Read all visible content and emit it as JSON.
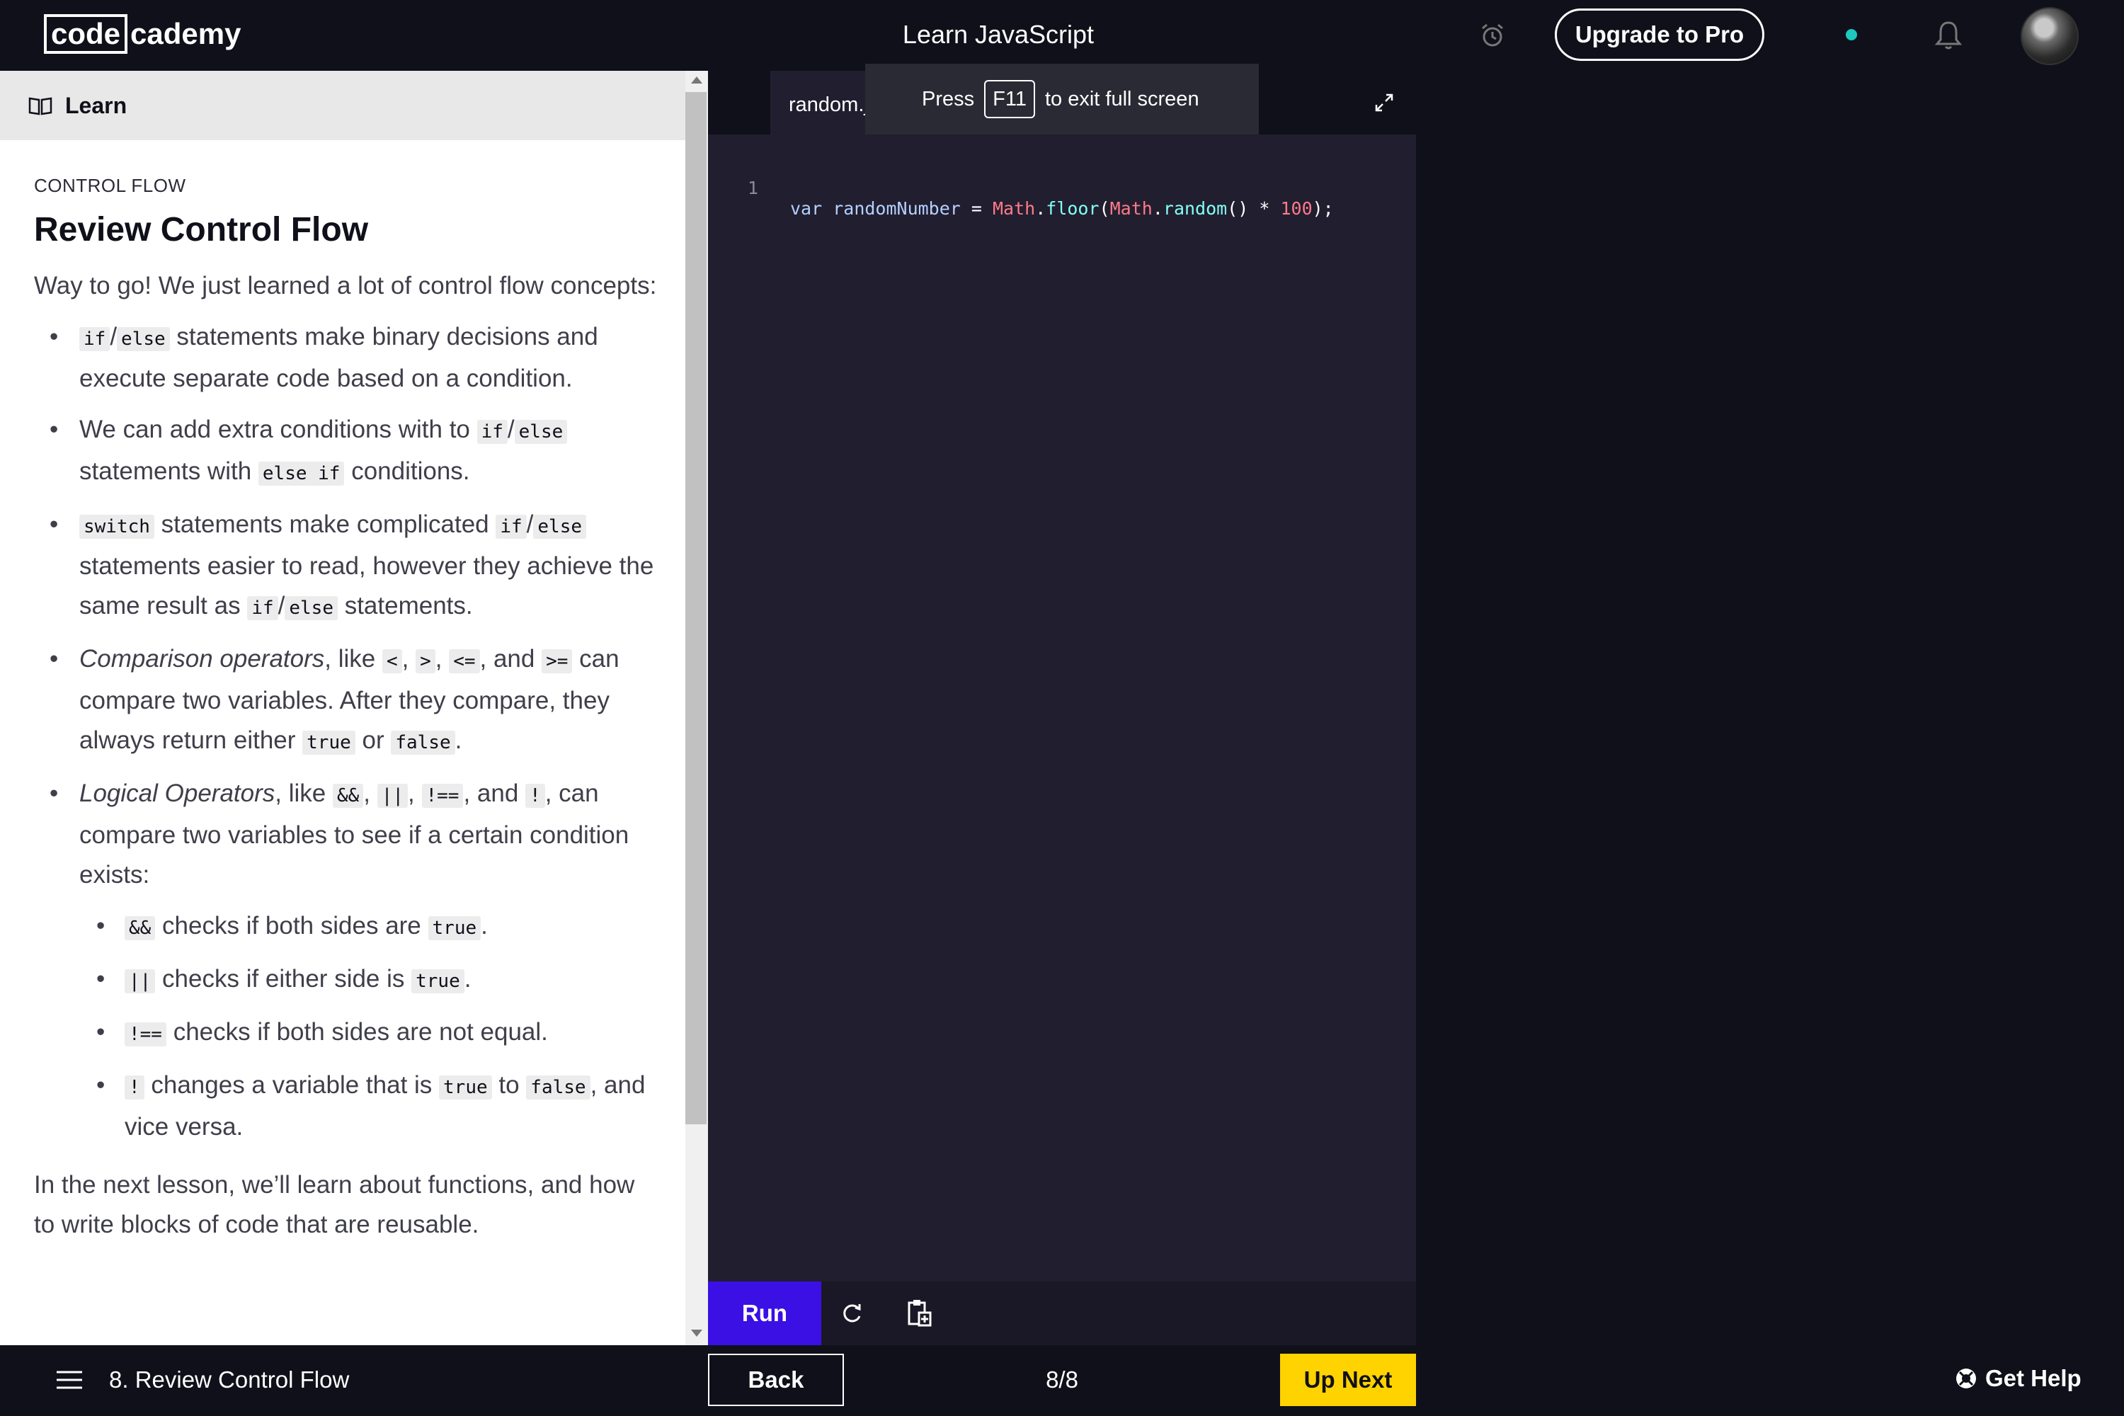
{
  "header": {
    "logo_box": "code",
    "logo_rest": "cademy",
    "title": "Learn JavaScript",
    "upgrade_label": "Upgrade to Pro",
    "status_color": "#1cc8c0"
  },
  "sidebar": {
    "tab_label": "Learn",
    "kicker": "CONTROL FLOW",
    "title": "Review Control Flow",
    "intro": "Way to go! We just learned a lot of control flow concepts:",
    "outro": "In the next lesson, we’ll learn about functions, and how to write blocks of code that are reusable.",
    "bullets": {
      "b1": {
        "c1": "if",
        "s1": "/",
        "c2": "else",
        "t1": " statements make binary decisions and execute separate code based on a condition."
      },
      "b2": {
        "t1": "We can add extra conditions with to ",
        "c1": "if",
        "s1": "/",
        "c2": "else",
        "t2": " statements with ",
        "c3": "else if",
        "t3": " conditions."
      },
      "b3": {
        "c1": "switch",
        "t1": " statements make complicated ",
        "c2": "if",
        "s1": "/",
        "c3": "else",
        "t2": " statements easier to read, however they achieve the same result as ",
        "c4": "if",
        "s2": "/",
        "c5": "else",
        "t3": " statements."
      },
      "b4": {
        "em": "Comparison operators",
        "t1": ", like ",
        "c1": "<",
        "s1": ", ",
        "c2": ">",
        "s2": ", ",
        "c3": "<=",
        "t2": ", and ",
        "c4": ">=",
        "t3": " can compare two variables. After they compare, they always return either ",
        "c5": "true",
        "t4": " or ",
        "c6": "false",
        "t5": "."
      },
      "b5": {
        "em": "Logical Operators",
        "t1": ", like ",
        "c1": "&&",
        "s1": ", ",
        "c2": "||",
        "s2": ", ",
        "c3": "!==",
        "t2": ", and ",
        "c4": "!",
        "t3": ", can compare two variables to see if a certain condition exists:"
      },
      "s1": {
        "c1": "&&",
        "t1": " checks if both sides are ",
        "c2": "true",
        "t2": "."
      },
      "s2": {
        "c1": "||",
        "t1": " checks if either side is ",
        "c2": "true",
        "t2": "."
      },
      "s3": {
        "c1": "!==",
        "t1": " checks if both sides are not equal."
      },
      "s4": {
        "c1": "!",
        "t1": " changes a variable that is ",
        "c2": "true",
        "t2": " to ",
        "c3": "false",
        "t3": ", and vice versa."
      }
    }
  },
  "editor": {
    "tab_label": "random.js",
    "toast_press": "Press",
    "toast_key": "F11",
    "toast_rest": "to exit full screen",
    "line_number": "1",
    "code": {
      "kw": "var",
      "name": "randomNumber",
      "eq": " = ",
      "obj1": "Math",
      "dot1": ".",
      "fn1": "floor",
      "p1": "(",
      "obj2": "Math",
      "dot2": ".",
      "fn2": "random",
      "p2": "() * ",
      "num": "100",
      "p3": ");"
    },
    "run_label": "Run"
  },
  "footer": {
    "lesson": "8. Review Control Flow",
    "back_label": "Back",
    "progress": "8/8",
    "next_label": "Up Next",
    "help_label": "Get Help"
  }
}
